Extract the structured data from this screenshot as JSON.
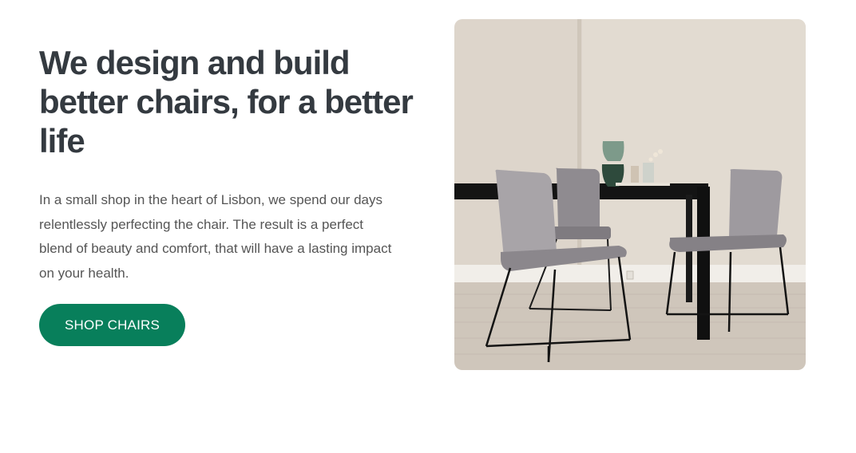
{
  "hero": {
    "title": "We design and build better chairs, for a better life",
    "description": "In a small shop in the heart of Lisbon, we spend our days relentlessly perfecting the chair. The result is a perfect blend of beauty and comfort, that will have a lasting impact on your health.",
    "cta_label": "SHOP CHAIRS",
    "image_subject": "dining-room-chairs-photo"
  },
  "colors": {
    "accent": "#087f5b",
    "heading": "#343a40",
    "body_text": "#555555"
  }
}
